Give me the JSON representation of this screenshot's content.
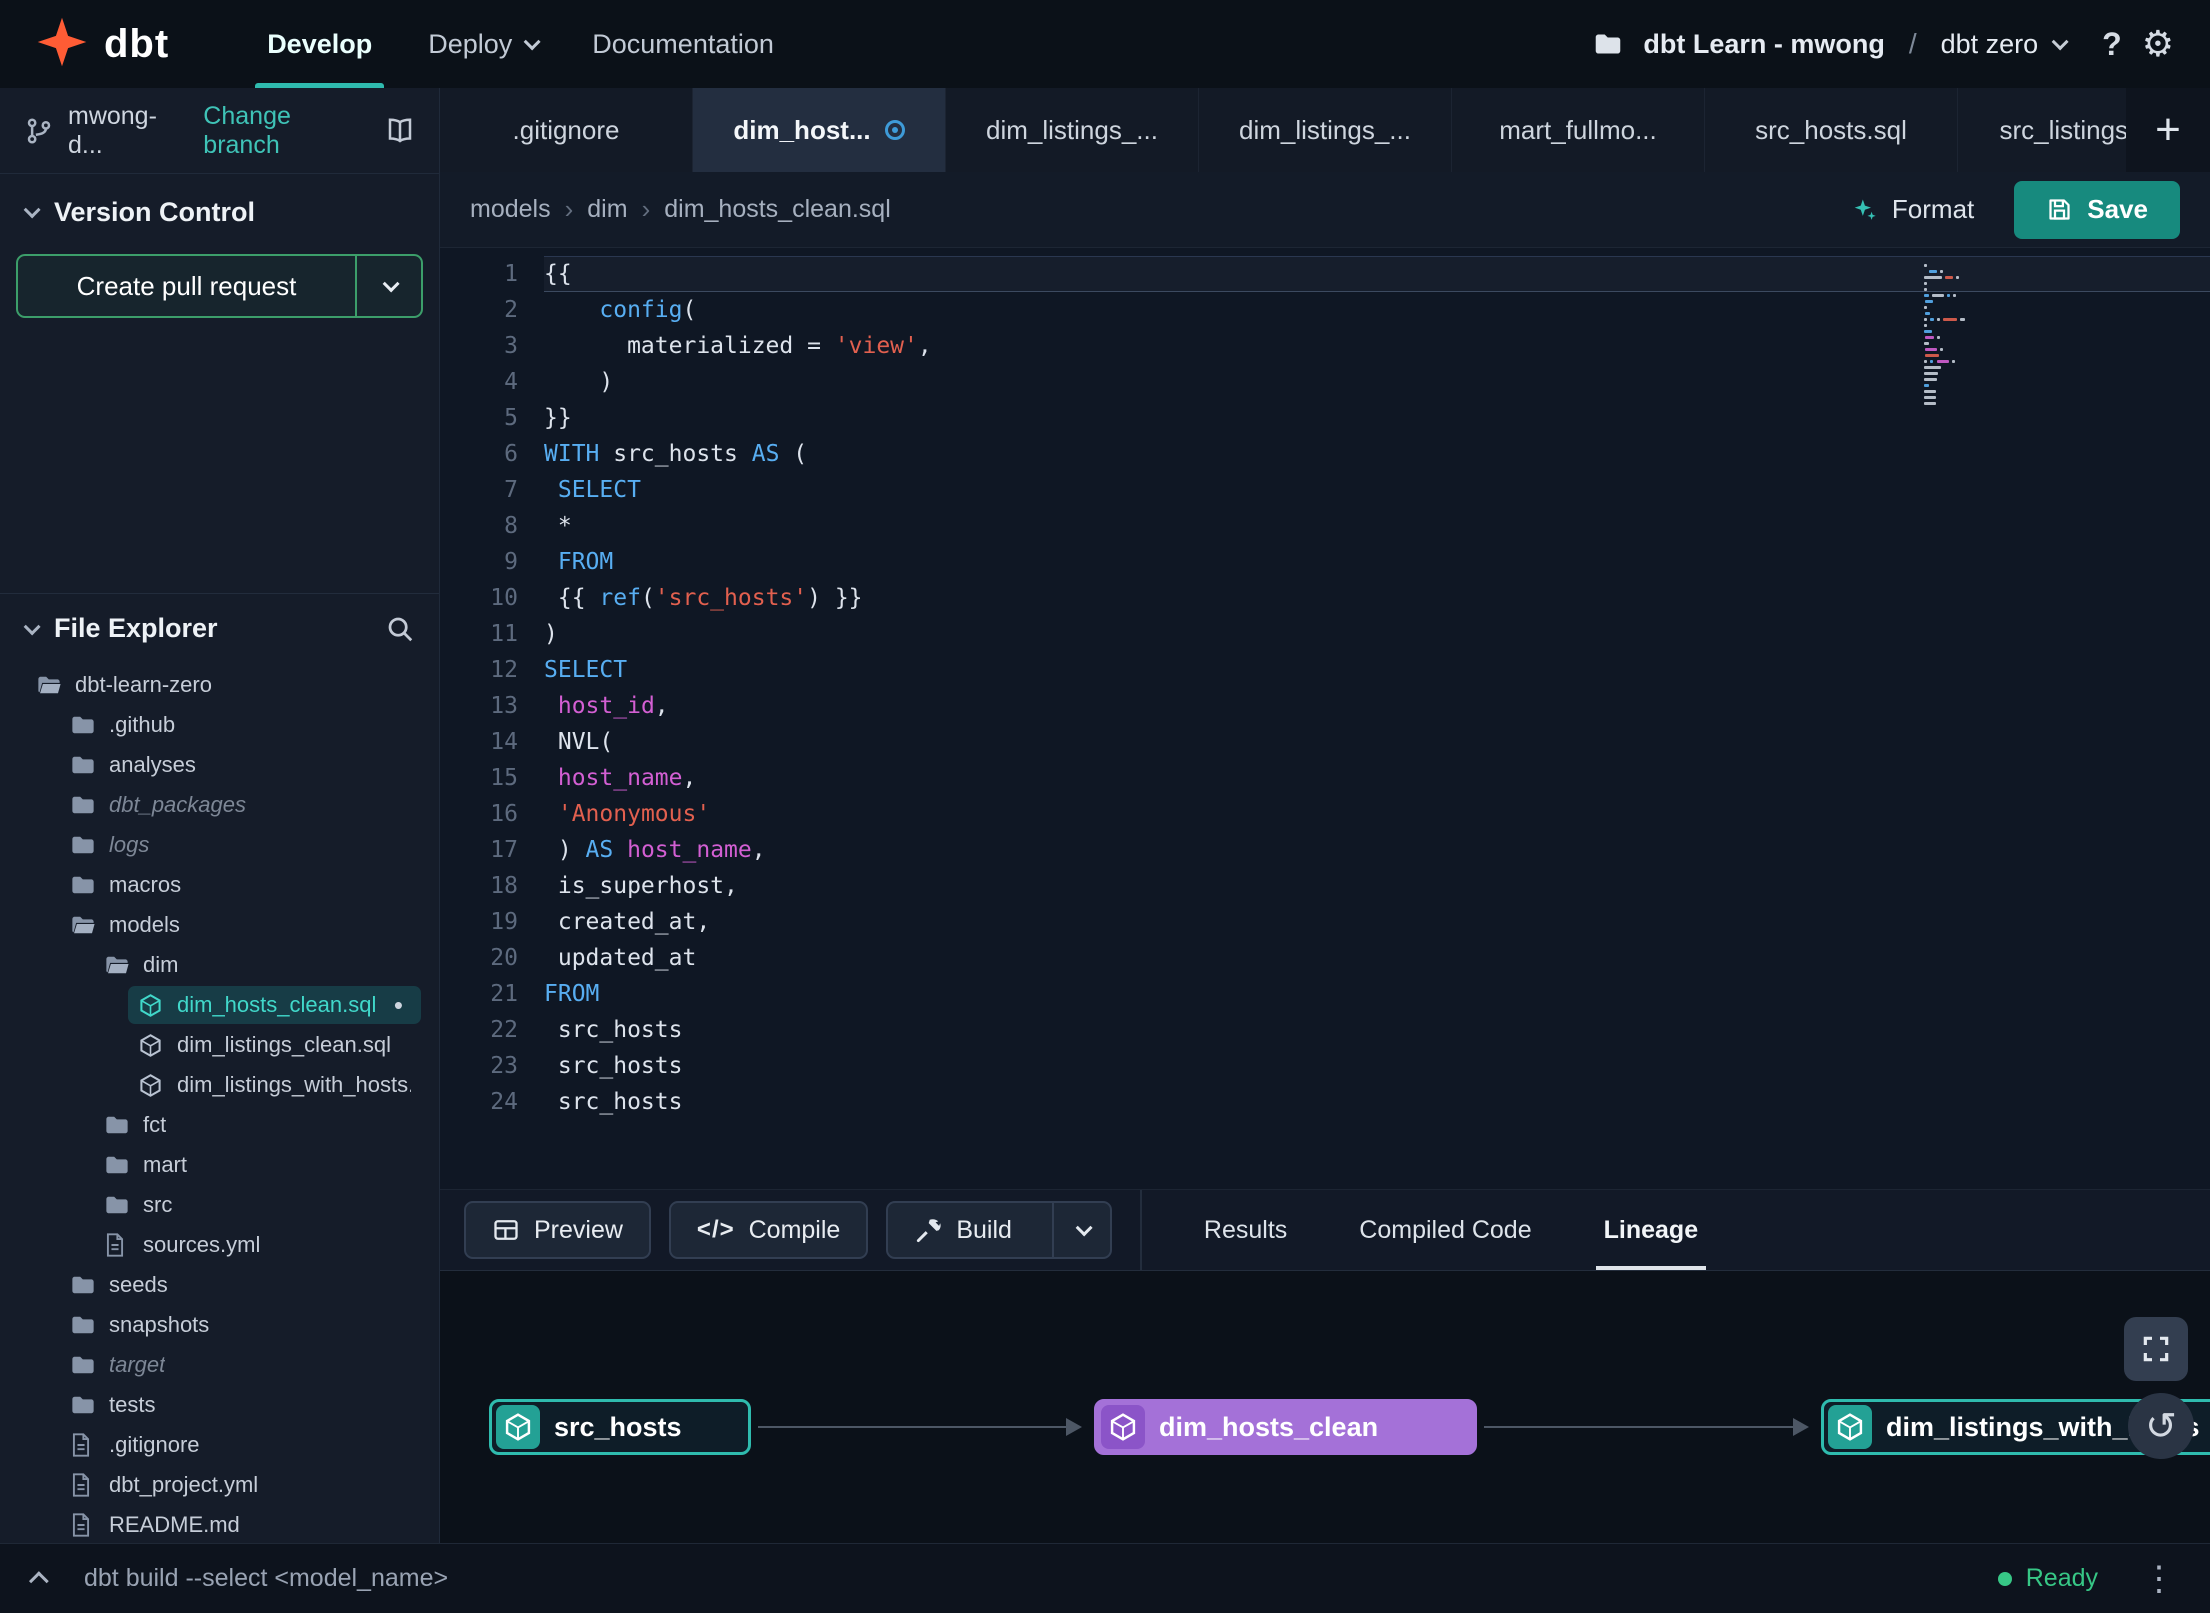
{
  "navbar": {
    "brand": "dbt",
    "menu": [
      {
        "label": "Develop",
        "active": true
      },
      {
        "label": "Deploy",
        "caret": true
      },
      {
        "label": "Documentation"
      }
    ],
    "project_name": "dbt Learn - mwong",
    "project_separator": "/",
    "environment": "dbt zero"
  },
  "glyphs": {
    "gear": "⚙",
    "help": "?",
    "kebab": "⋮",
    "reset": "↺",
    "new_tab": "+",
    "compile": "</>",
    "dot": "•"
  },
  "sidebar": {
    "branch_name": "mwong-d...",
    "change_branch": "Change branch",
    "version_control_title": "Version Control",
    "create_pr_label": "Create pull request",
    "file_explorer_title": "File Explorer",
    "tree": [
      {
        "label": "dbt-learn-zero",
        "icon": "folder-open",
        "level": 0
      },
      {
        "label": ".github",
        "icon": "folder",
        "level": 1
      },
      {
        "label": "analyses",
        "icon": "folder",
        "level": 1
      },
      {
        "label": "dbt_packages",
        "icon": "folder",
        "level": 1,
        "muted": true
      },
      {
        "label": "logs",
        "icon": "folder",
        "level": 1,
        "muted": true
      },
      {
        "label": "macros",
        "icon": "folder",
        "level": 1
      },
      {
        "label": "models",
        "icon": "folder-open",
        "level": 1
      },
      {
        "label": "dim",
        "icon": "folder-open",
        "level": 2
      },
      {
        "label": "dim_hosts_clean.sql",
        "icon": "model",
        "level": 3,
        "selected": true,
        "modified": true
      },
      {
        "label": "dim_listings_clean.sql",
        "icon": "model",
        "level": 3
      },
      {
        "label": "dim_listings_with_hosts...",
        "icon": "model",
        "level": 3
      },
      {
        "label": "fct",
        "icon": "folder",
        "level": 2
      },
      {
        "label": "mart",
        "icon": "folder",
        "level": 2
      },
      {
        "label": "src",
        "icon": "folder",
        "level": 2
      },
      {
        "label": "sources.yml",
        "icon": "file",
        "level": 2
      },
      {
        "label": "seeds",
        "icon": "folder",
        "level": 1
      },
      {
        "label": "snapshots",
        "icon": "folder",
        "level": 1
      },
      {
        "label": "target",
        "icon": "folder",
        "level": 1,
        "muted": true
      },
      {
        "label": "tests",
        "icon": "folder",
        "level": 1
      },
      {
        "label": ".gitignore",
        "icon": "file",
        "level": 1
      },
      {
        "label": "dbt_project.yml",
        "icon": "file",
        "level": 1
      },
      {
        "label": "README.md",
        "icon": "file",
        "level": 1
      }
    ]
  },
  "tabs": [
    {
      "label": ".gitignore"
    },
    {
      "label": "dim_host...",
      "active": true,
      "modified": true
    },
    {
      "label": "dim_listings_..."
    },
    {
      "label": "dim_listings_..."
    },
    {
      "label": "mart_fullmo..."
    },
    {
      "label": "src_hosts.sql"
    },
    {
      "label": "src_listings.sql"
    }
  ],
  "breadcrumb": [
    "models",
    "dim",
    "dim_hosts_clean.sql"
  ],
  "toolbar": {
    "format_label": "Format",
    "save_label": "Save"
  },
  "editor": {
    "lines": [
      [
        {
          "t": "{{"
        }
      ],
      [
        {
          "t": "    "
        },
        {
          "t": "config",
          "c": "kw"
        },
        {
          "t": "("
        }
      ],
      [
        {
          "t": "      materialized = "
        },
        {
          "t": "'view'",
          "c": "str"
        },
        {
          "t": ","
        }
      ],
      [
        {
          "t": "    )"
        }
      ],
      [
        {
          "t": "}}"
        }
      ],
      [
        {
          "t": "WITH",
          "c": "kw"
        },
        {
          "t": " src_hosts "
        },
        {
          "t": "AS",
          "c": "kw"
        },
        {
          "t": " ("
        }
      ],
      [
        {
          "t": " "
        },
        {
          "t": "SELECT",
          "c": "kw"
        }
      ],
      [
        {
          "t": " *"
        }
      ],
      [
        {
          "t": " "
        },
        {
          "t": "FROM",
          "c": "kw"
        }
      ],
      [
        {
          "t": " {{ "
        },
        {
          "t": "ref",
          "c": "kw"
        },
        {
          "t": "("
        },
        {
          "t": "'src_hosts'",
          "c": "str"
        },
        {
          "t": ") }}"
        }
      ],
      [
        {
          "t": ")"
        }
      ],
      [
        {
          "t": "SELECT",
          "c": "kw"
        }
      ],
      [
        {
          "t": " "
        },
        {
          "t": "host_id",
          "c": "id"
        },
        {
          "t": ","
        }
      ],
      [
        {
          "t": " NVL("
        }
      ],
      [
        {
          "t": " "
        },
        {
          "t": "host_name",
          "c": "id"
        },
        {
          "t": ","
        }
      ],
      [
        {
          "t": " "
        },
        {
          "t": "'Anonymous'",
          "c": "str"
        }
      ],
      [
        {
          "t": " ) "
        },
        {
          "t": "AS",
          "c": "kw"
        },
        {
          "t": " "
        },
        {
          "t": "host_name",
          "c": "id"
        },
        {
          "t": ","
        }
      ],
      [
        {
          "t": " is_superhost,"
        }
      ],
      [
        {
          "t": " created_at,"
        }
      ],
      [
        {
          "t": " updated_at"
        }
      ],
      [
        {
          "t": "FROM",
          "c": "kw"
        }
      ],
      [
        {
          "t": " src_hosts"
        }
      ],
      [
        {
          "t": " src_hosts"
        }
      ],
      [
        {
          "t": " src_hosts"
        }
      ]
    ]
  },
  "actionbar": {
    "preview_label": "Preview",
    "compile_label": "Compile",
    "build_label": "Build",
    "tabs": [
      {
        "label": "Results"
      },
      {
        "label": "Compiled Code"
      },
      {
        "label": "Lineage",
        "active": true
      }
    ]
  },
  "lineage": {
    "nodes": [
      {
        "label": "src_hosts",
        "style": "teal"
      },
      {
        "label": "dim_hosts_clean",
        "style": "purple"
      },
      {
        "label": "dim_listings_with_hosts",
        "style": "teal"
      }
    ]
  },
  "statusbar": {
    "command": "dbt build --select <model_name>",
    "status": "Ready"
  }
}
